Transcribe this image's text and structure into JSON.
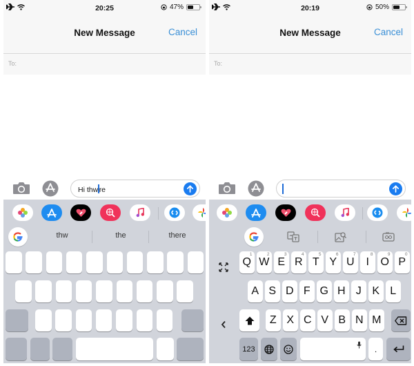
{
  "left_screen": {
    "status": {
      "time": "20:25",
      "battery_percent": "47%",
      "battery_level": 0.47,
      "icons": [
        "airplane-icon",
        "wifi-icon",
        "orientation-lock-icon"
      ]
    },
    "nav": {
      "title": "New Message",
      "cancel_label": "Cancel"
    },
    "to_label": "To:",
    "message": {
      "text_before_caret": "Hi thw",
      "text_after_caret": "re"
    },
    "suggestions": [
      "thw",
      "the",
      "there"
    ],
    "keyboard_state": "blank-keys"
  },
  "right_screen": {
    "status": {
      "time": "20:19",
      "battery_percent": "50%",
      "battery_level": 0.5,
      "icons": [
        "airplane-icon",
        "wifi-icon",
        "orientation-lock-icon"
      ]
    },
    "nav": {
      "title": "New Message",
      "cancel_label": "Cancel"
    },
    "to_label": "To:",
    "message": {
      "text": ""
    },
    "tools": [
      "translate-icon",
      "image-search-icon",
      "gif-icon"
    ],
    "keyboard": {
      "row1": [
        {
          "key": "Q",
          "hint": "1"
        },
        {
          "key": "W",
          "hint": "2"
        },
        {
          "key": "E",
          "hint": "3"
        },
        {
          "key": "R",
          "hint": "4"
        },
        {
          "key": "T",
          "hint": "5"
        },
        {
          "key": "Y",
          "hint": "6"
        },
        {
          "key": "U",
          "hint": "7"
        },
        {
          "key": "I",
          "hint": "8"
        },
        {
          "key": "O",
          "hint": "9"
        },
        {
          "key": "P",
          "hint": "0"
        }
      ],
      "row2": [
        "A",
        "S",
        "D",
        "F",
        "G",
        "H",
        "J",
        "K",
        "L"
      ],
      "row3": [
        "Z",
        "X",
        "C",
        "V",
        "B",
        "N",
        "M"
      ],
      "numbers_label": "123",
      "period_label": "."
    }
  },
  "app_drawer": [
    "photos",
    "app-store",
    "digital-touch",
    "web-images",
    "music",
    "shazam",
    "google-photos"
  ],
  "colors": {
    "accent": "#3a8fd6",
    "send_button": "#1a7cf0",
    "keyboard_bg": "#d1d4db",
    "dark_key": "#aeb3be",
    "header_bg": "#f7f7f7"
  }
}
